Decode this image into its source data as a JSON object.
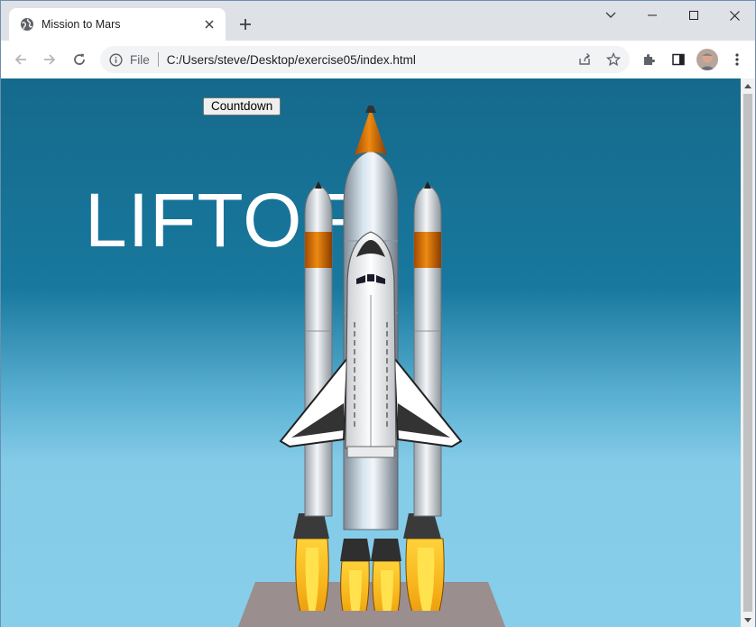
{
  "tab": {
    "title": "Mission to Mars",
    "favicon": "globe-icon"
  },
  "toolbar": {
    "scheme_label": "File",
    "url": "C:/Users/steve/Desktop/exercise05/index.html"
  },
  "page": {
    "countdown_label": "Countdown",
    "headline": "LIFTOFF"
  },
  "colors": {
    "sky_top": "#156a8c",
    "sky_bottom": "#87ceeb",
    "launchpad": "#9a8e8f",
    "flame_outer": "#f7b21a",
    "flame_inner": "#ffe24d"
  }
}
